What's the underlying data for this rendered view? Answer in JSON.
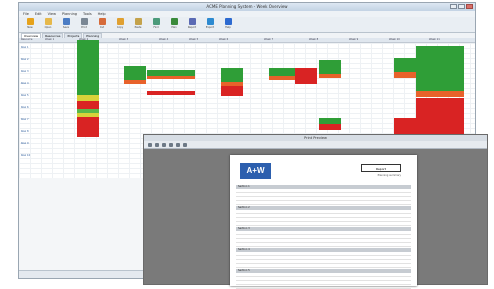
{
  "window": {
    "title": "ACME Planning System - Week Overview",
    "menu": [
      "File",
      "Edit",
      "View",
      "Planning",
      "Tools",
      "Help"
    ]
  },
  "toolbar": [
    {
      "label": "New",
      "icon": "new-icon",
      "color": "#e6a21a"
    },
    {
      "label": "Open",
      "icon": "folder-icon",
      "color": "#e6b84a"
    },
    {
      "label": "Save",
      "icon": "save-icon",
      "color": "#4a7cc4"
    },
    {
      "label": "Print",
      "icon": "print-icon",
      "color": "#7a8794"
    },
    {
      "label": "Cut",
      "icon": "cut-icon",
      "color": "#d66b3a"
    },
    {
      "label": "Copy",
      "icon": "copy-icon",
      "color": "#e0a030"
    },
    {
      "label": "Paste",
      "icon": "paste-icon",
      "color": "#c4a24a"
    },
    {
      "label": "Find",
      "icon": "find-icon",
      "color": "#4a9a7a"
    },
    {
      "label": "Plan",
      "icon": "plan-icon",
      "color": "#3a8a3a"
    },
    {
      "label": "Report",
      "icon": "report-icon",
      "color": "#5a6ab4"
    },
    {
      "label": "Export",
      "icon": "export-icon",
      "color": "#2d8ad0"
    },
    {
      "label": "Help",
      "icon": "help-icon",
      "color": "#2d6ad0"
    }
  ],
  "tabs": [
    "Overview",
    "Resources",
    "Projects",
    "Planning"
  ],
  "grid_columns": [
    "Resource",
    "Week 1",
    "Week 2",
    "Week 3",
    "Week 4",
    "Week 5",
    "Week 6",
    "Week 7",
    "Week 8",
    "Week 9",
    "Week 10",
    "Week 11"
  ],
  "grid_rows": [
    "Row 1",
    "Row 2",
    "Row 3",
    "Row 4",
    "Row 5",
    "Row 6",
    "Row 7",
    "Row 8",
    "Row 9",
    "Row 10"
  ],
  "colors": {
    "green": "#2f9e37",
    "green_light": "#59b84a",
    "red": "#d92323",
    "orange": "#e8622b",
    "yellow": "#d8d23a"
  },
  "preview": {
    "title": "Print Preview",
    "logo": "A+W",
    "report_title": "Report",
    "report_sub": "Planning summary",
    "sections": [
      "Section 1",
      "Section 2",
      "Section 3",
      "Section 4",
      "Section 5"
    ]
  }
}
